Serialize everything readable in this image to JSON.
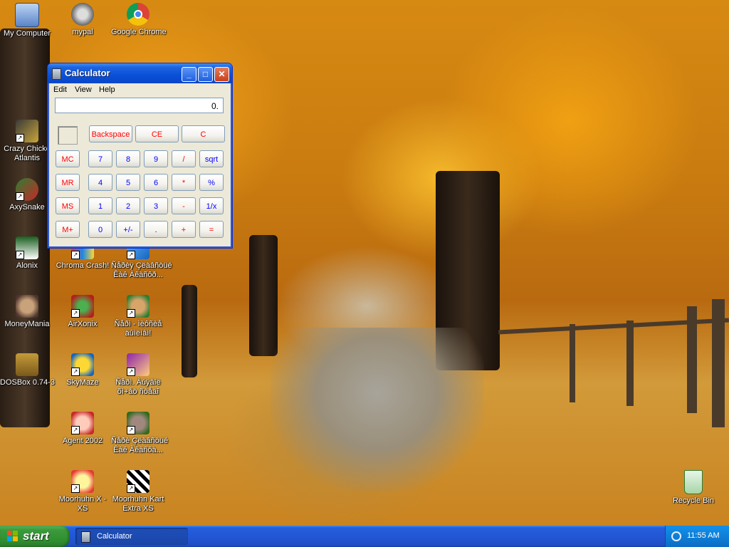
{
  "desktop": {
    "icons": [
      {
        "label": "My Computer"
      },
      {
        "label": "mypal"
      },
      {
        "label": "Google Chrome"
      },
      {
        "label": "Crazy Chicke\nAtlantis"
      },
      {
        "label": "AxySnake"
      },
      {
        "label": "Alonix"
      },
      {
        "label": "Chroma Crash!"
      },
      {
        "label": "Ñåðèÿ Çëàâñòüé\nÊàê Àêàñôð..."
      },
      {
        "label": "MoneyMania"
      },
      {
        "label": "AirXonix"
      },
      {
        "label": "Ñåðì - ìèôñèå\näûìëíâì!"
      },
      {
        "label": "DOSBox 0.74-3"
      },
      {
        "label": "SkyMaze"
      },
      {
        "label": "Ñåðì. Àúÿâîë\nõì+åò ñòåäî"
      },
      {
        "label": "Agent 2002"
      },
      {
        "label": "Ñåðè Çëàâñòüé\nÊàê Àêàñôà..."
      },
      {
        "label": "Moorhuhn X -\nXS"
      },
      {
        "label": "Moorhuhn Kart\nExtra XS"
      },
      {
        "label": "Recycle Bin"
      }
    ]
  },
  "calculator": {
    "title": "Calculator",
    "menu": [
      "Edit",
      "View",
      "Help"
    ],
    "display": "0.",
    "top_row": [
      "Backspace",
      "CE",
      "C"
    ],
    "memory_buttons": [
      "MC",
      "MR",
      "MS",
      "M+"
    ],
    "rows": [
      [
        "7",
        "8",
        "9",
        "/",
        "sqrt"
      ],
      [
        "4",
        "5",
        "6",
        "*",
        "%"
      ],
      [
        "1",
        "2",
        "3",
        "-",
        "1/x"
      ],
      [
        "0",
        "+/-",
        ".",
        "+",
        "="
      ]
    ],
    "colors": {
      "digit": "#0000ff",
      "operator": "#ff0000"
    }
  },
  "taskbar": {
    "start_label": "start",
    "items": [
      {
        "label": "Calculator"
      }
    ],
    "clock": "11:55 AM"
  }
}
